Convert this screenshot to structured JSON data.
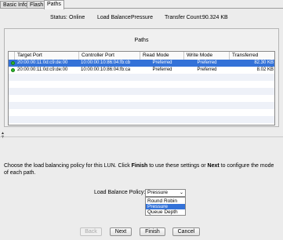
{
  "tabs": [
    {
      "label": "Basic Info"
    },
    {
      "label": "Flash"
    },
    {
      "label": "Paths"
    }
  ],
  "status": {
    "status_label": "Status:",
    "status_value": "Online",
    "load_balance_label": "Load Balance:",
    "load_balance_value": "Pressure",
    "transfer_count_label": "Transfer Count:",
    "transfer_count_value": "90.324 KB"
  },
  "paths": {
    "title": "Paths",
    "columns": [
      "Target Port",
      "Controller Port",
      "Read Mode",
      "Write Mode",
      "Transferred"
    ],
    "rows": [
      {
        "target_port": "20:00:00:11:0d:c9:de:00",
        "controller_port": "10:00:00:10:86:04:fb:cb",
        "read_mode": "Preferred",
        "write_mode": "Preferred",
        "transferred": "82.30 KB",
        "status_color": "#2db52d"
      },
      {
        "target_port": "20:00:00:11:0d:c9:de:00",
        "controller_port": "10:00:00:10:86:04:fb:ca",
        "read_mode": "Preferred",
        "write_mode": "Preferred",
        "transferred": "8.02 KB",
        "status_color": "#2db52d"
      }
    ]
  },
  "instruction": {
    "before_finish": "Choose the load balancing policy for this LUN. Click ",
    "finish": "Finish",
    "middle": " to use these settings or ",
    "next": "Next",
    "after_next": " to configure the mode of each path."
  },
  "policy": {
    "label": "Load Balance Policy:",
    "selected": "Pressure",
    "options": [
      "Round Robin",
      "Pressure",
      "Queue Depth"
    ]
  },
  "buttons": {
    "back": "Back",
    "next": "Next",
    "finish": "Finish",
    "cancel": "Cancel"
  },
  "colors": {
    "selection": "#3472d8",
    "status_ok": "#2db52d"
  }
}
